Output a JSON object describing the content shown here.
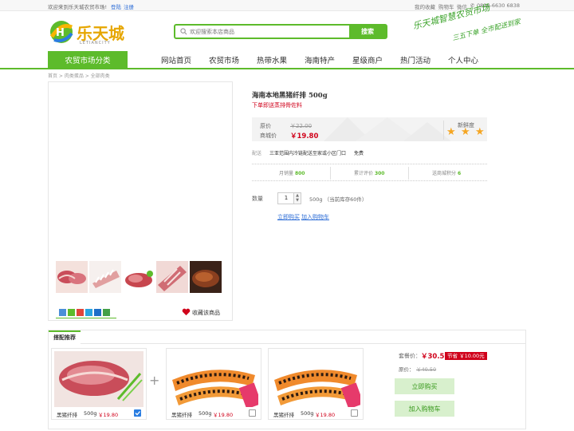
{
  "topbar": {
    "welcome": "欢迎来到乐天城农贸市场!",
    "login": "登陆",
    "register": "注册",
    "my_orders": "我的收藏",
    "cart": "购物车",
    "wechat": "微信",
    "phone": "0898-6630 6838"
  },
  "header": {
    "logo_text": "乐天城",
    "logo_sub": "LETIANCITY",
    "search_placeholder": "欢迎搜索本店商品",
    "search_button": "搜索",
    "slogan_line1": "乐天城智慧农贸市场",
    "slogan_line2": "三五下单 全市配送到家"
  },
  "nav": {
    "category_button": "农贸市场分类",
    "items": [
      "网站首页",
      "农贸市场",
      "热带水果",
      "海南特产",
      "星级商户",
      "热门活动",
      "个人中心"
    ]
  },
  "breadcrumb": "首页 > 肉类蛋品 > 全部肉类",
  "product": {
    "title": "海南本地黑猪纤排 500g",
    "promo": "下单即送蒸排骨佐料",
    "orig_label": "原价",
    "orig_price": "￥22.00",
    "mall_label": "商城价",
    "mall_price": "￥19.80",
    "freshness_label": "新鲜度",
    "freshness_stars": 3,
    "ship_label": "配送",
    "ship_text": "三亚范围内冷链配送至家或小区门口",
    "ship_free": "免费",
    "stats": [
      {
        "label": "月销量",
        "value": "800"
      },
      {
        "label": "累计评价",
        "value": "300"
      },
      {
        "label": "送商城积分",
        "value": "6"
      }
    ],
    "qty_label": "数量",
    "qty_value": "1",
    "stock": "500g （当前库存60件）",
    "buy_now": "立即购买",
    "add_cart": "加入购物车",
    "favorite": "收藏该商品"
  },
  "combo": {
    "tab": "搭配推荐",
    "items": [
      {
        "name": "黑猪纤排",
        "weight": "500g",
        "price": "￥19.80",
        "checked": true
      },
      {
        "name": "黑猪纤排",
        "weight": "500g",
        "price": "￥19.80",
        "checked": false
      },
      {
        "name": "黑猪纤排",
        "weight": "500g",
        "price": "￥19.80",
        "checked": false
      }
    ],
    "set_label": "套餐价：",
    "set_price": "￥30.50",
    "save_badge": "节省 ￥10.00元",
    "orig_label": "原价：",
    "orig_price": "￥40.50",
    "buy_button": "立即购买",
    "cart_button": "加入购物车"
  },
  "colors": {
    "brand_green": "#5dbb2b",
    "price_red": "#d0021b",
    "star": "#f5a623"
  }
}
